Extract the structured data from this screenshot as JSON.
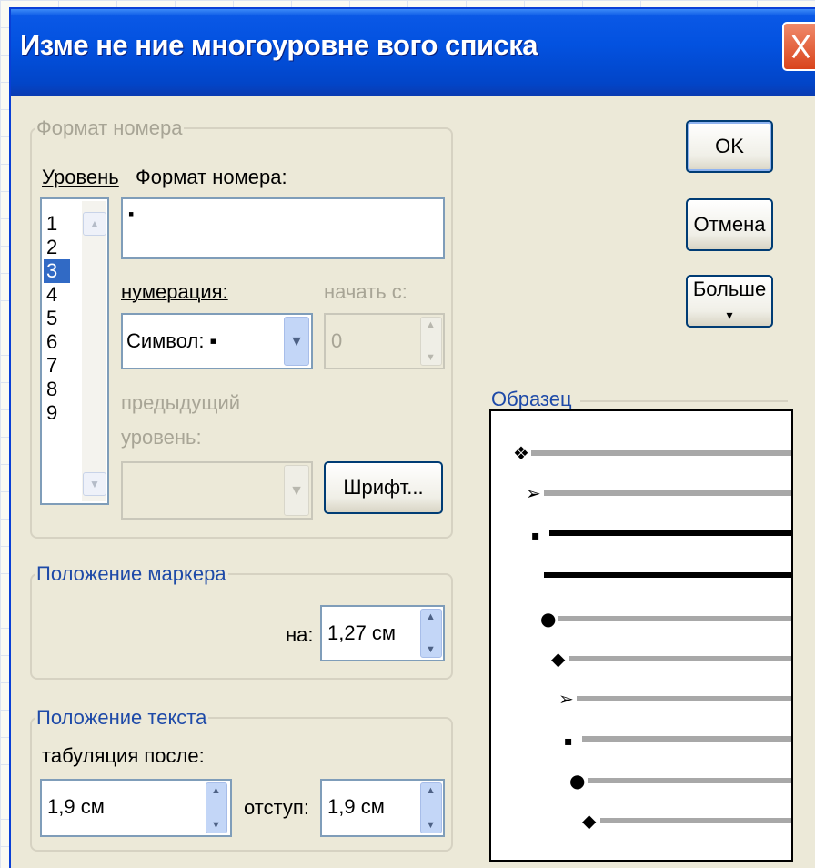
{
  "window": {
    "title": "Изме не ние многоуровне вого списка"
  },
  "number_format_group": {
    "legend": "Формат номера",
    "level_label": "Уровень",
    "format_label": "Формат номера:",
    "format_value": "▪",
    "levels": [
      "1",
      "2",
      "3",
      "4",
      "5",
      "6",
      "7",
      "8",
      "9"
    ],
    "selected_level": "3",
    "numbering_label": "нумерация:",
    "numbering_value": "Символ: ▪",
    "start_label": "начать с:",
    "start_value": "0",
    "prev_level_label_1": "предыдущий",
    "prev_level_label_2": "уровень:",
    "font_button": "Шрифт..."
  },
  "marker_group": {
    "legend": "Положение маркера",
    "at_label": "на:",
    "at_value": "1,27 см"
  },
  "text_group": {
    "legend": "Положение текста",
    "tab_label": "табуляция после:",
    "tab_value": "1,9 см",
    "indent_label": "отступ:",
    "indent_value": "1,9 см"
  },
  "buttons": {
    "ok": "OK",
    "cancel": "Отмена",
    "more": "Больше",
    "more_arrow": "▾"
  },
  "preview": {
    "label": "Образец",
    "rows": [
      {
        "bullet": "❖",
        "bold": false
      },
      {
        "bullet": "➢",
        "bold": false
      },
      {
        "bullet": "▪",
        "bold": true
      },
      {
        "bullet": "",
        "bold": true
      },
      {
        "bullet": "●",
        "bold": false
      },
      {
        "bullet": "◆",
        "bold": false
      },
      {
        "bullet": "➢",
        "bold": false
      },
      {
        "bullet": "▪",
        "bold": false
      },
      {
        "bullet": "●",
        "bold": false
      },
      {
        "bullet": "◆",
        "bold": false
      }
    ]
  },
  "colors": {
    "titlebar": "#0352e0",
    "dialog_bg": "#ece9d8",
    "selection": "#316ac5",
    "group_label": "#1e4aa8"
  }
}
